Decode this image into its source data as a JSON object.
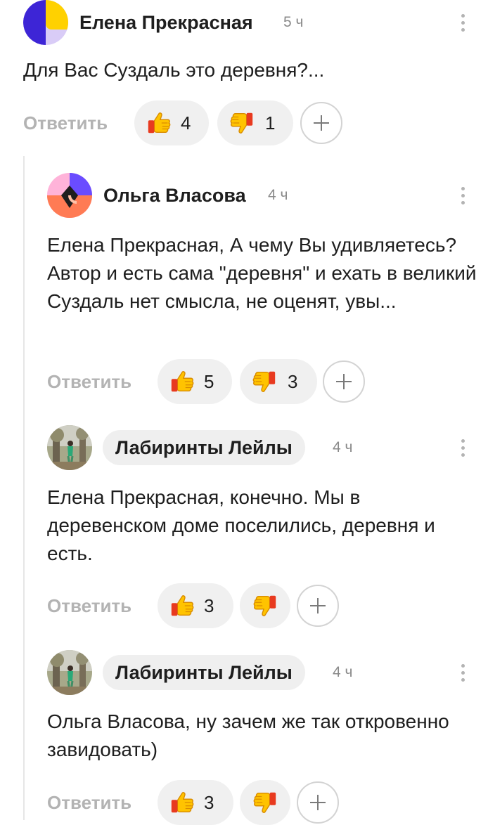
{
  "comments": [
    {
      "author": "Елена Прекрасная",
      "time": "5 ч",
      "text": "Для Вас Суздаль это деревня?...",
      "reply_label": "Ответить",
      "likes": "4",
      "dislikes": "1"
    },
    {
      "author": "Ольга Власова",
      "time": "4 ч",
      "text": "Елена Прекрасная, А чему Вы удивляетесь? Автор и есть сама \"деревня\" и ехать в великий Суздаль нет смысла, не оценят, увы...",
      "reply_label": "Ответить",
      "likes": "5",
      "dislikes": "3"
    },
    {
      "author": "Лабиринты Лейлы",
      "time": "4 ч",
      "text": "Елена Прекрасная, конечно. Мы в деревенском доме поселились, деревня и есть.",
      "reply_label": "Ответить",
      "likes": "3",
      "dislikes": ""
    },
    {
      "author": "Лабиринты Лейлы",
      "time": "4 ч",
      "text": "Ольга Власова, ну зачем же так откровенно завидовать)",
      "reply_label": "Ответить",
      "likes": "3",
      "dislikes": ""
    }
  ],
  "icons": {
    "like": "thumbs-up-icon",
    "dislike": "thumbs-down-icon",
    "add_reaction": "plus-icon",
    "menu": "more-vertical-icon"
  },
  "colors": {
    "reply": "#b3b3b3",
    "pill_bg": "#f0f0f0",
    "time": "#8a8a8a",
    "thread_line": "#e6e6e6"
  }
}
